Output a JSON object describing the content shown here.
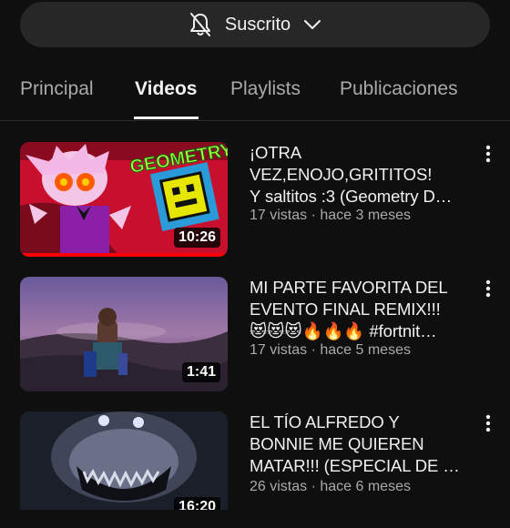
{
  "subscribe": {
    "label": "Suscrito",
    "bell_icon": "bell-off-icon",
    "chevron_icon": "chevron-down-icon"
  },
  "tabs": [
    {
      "label": "Principal"
    },
    {
      "label": "Videos",
      "active": true
    },
    {
      "label": "Playlists"
    },
    {
      "label": "Publicaciones"
    }
  ],
  "videos": [
    {
      "title_lines": [
        "¡OTRA",
        "VEZ,ENOJO,GRITITOS!",
        "Y saltitos :3 (Geometry D…"
      ],
      "meta": "17 vistas · hace 3 meses",
      "duration": "10:26",
      "thumb_text": "GEOMETRY",
      "watched_fraction": 1.0
    },
    {
      "title_lines": [
        "MI PARTE FAVORITA DEL",
        "EVENTO FINAL REMIX!!!",
        "😻😻😻🔥🔥🔥 #fortnit…"
      ],
      "meta": "17 vistas · hace 5 meses",
      "duration": "1:41"
    },
    {
      "title_lines": [
        "EL TÍO ALFREDO Y",
        "BONNIE ME QUIEREN",
        "MATAR!!! (ESPECIAL DE …"
      ],
      "meta": "26 vistas · hace 6 meses",
      "duration": "16:20"
    }
  ],
  "colors": {
    "background": "#0f0f0f",
    "progress": "#ff0000",
    "pill": "#272727",
    "secondary_text": "#aaaaaa"
  }
}
